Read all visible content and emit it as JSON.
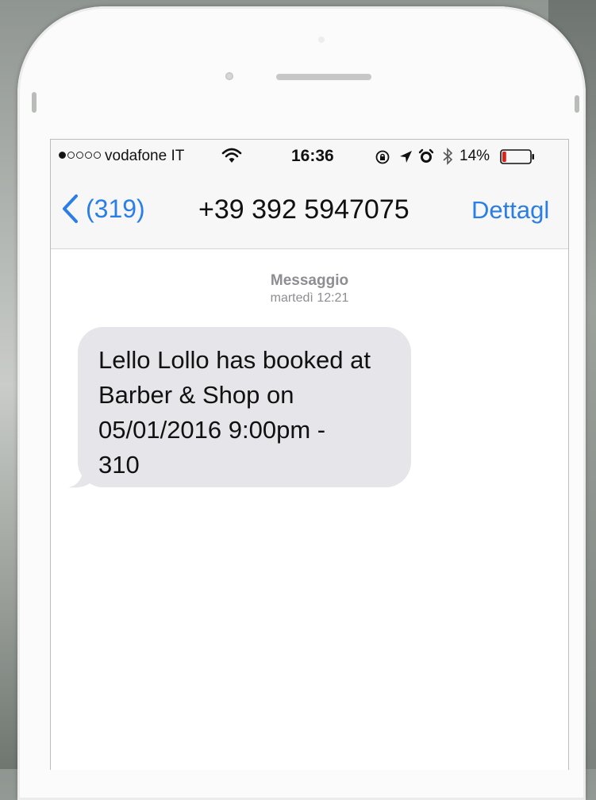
{
  "status_bar": {
    "signal_dots_filled": 1,
    "signal_dots_total": 5,
    "carrier": "vodafone IT",
    "time": "16:36",
    "battery_percent": "14%",
    "battery_level": 0.14,
    "battery_color": "#e0201b",
    "icons": [
      "wifi-icon",
      "rotation-lock-icon",
      "location-icon",
      "alarm-icon",
      "bluetooth-icon",
      "battery-icon"
    ]
  },
  "nav": {
    "back_label": "(319)",
    "title": "+39 392 5947075",
    "details_label": "Dettagl",
    "accent_color": "#2a7ee6"
  },
  "conversation": {
    "meta_type": "Messaggio",
    "meta_time": "martedì 12:21",
    "messages": [
      {
        "lines": [
          "Lello Lollo has booked at",
          "Barber & Shop on",
          "05/01/2016 9:00pm -",
          "310"
        ],
        "bubble_color": "#e5e5ea"
      }
    ]
  }
}
